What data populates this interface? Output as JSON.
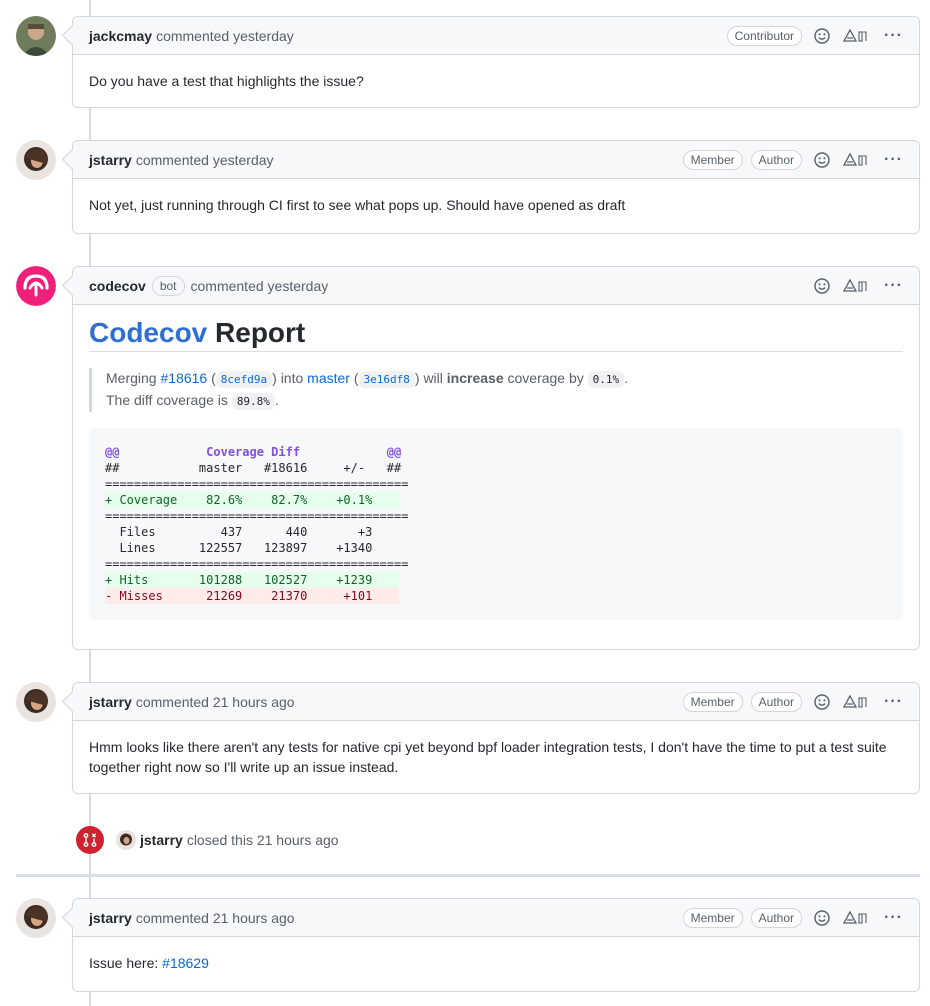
{
  "timeline": [
    {
      "author": "jackcmay",
      "timestamp": "commented yesterday",
      "badges": [
        "Contributor"
      ],
      "body": "Do you have a test that highlights the issue?"
    },
    {
      "author": "jstarry",
      "timestamp": "commented yesterday",
      "badges": [
        "Member",
        "Author"
      ],
      "body": "Not yet, just running through CI first to see what pops up. Should have opened as draft"
    },
    {
      "author": "codecov",
      "bot_label": "bot",
      "timestamp": "commented yesterday",
      "report": {
        "title_brand": "Codecov",
        "title_rest": "Report",
        "merge_text": {
          "merging": "Merging",
          "pr_link": "#18616",
          "head_sha": "8cefd9a",
          "into": "into",
          "base_branch": "master",
          "base_sha": "3e16df8",
          "will": "will",
          "increase": "increase",
          "coverage_by": "coverage by",
          "delta": "0.1%",
          "diff_coverage_text": "The diff coverage is",
          "diff_coverage": "89.8%"
        },
        "diff_lines": [
          {
            "kind": "hunk",
            "text": "@@            Coverage Diff            @@"
          },
          {
            "kind": "plain",
            "text": "##           master   #18616     +/-   ##"
          },
          {
            "kind": "sep",
            "text": "=========================================="
          },
          {
            "kind": "add",
            "text": "+ Coverage    82.6%    82.7%    +0.1%     "
          },
          {
            "kind": "sep",
            "text": "=========================================="
          },
          {
            "kind": "plain",
            "text": "  Files         437      440       +3     "
          },
          {
            "kind": "plain",
            "text": "  Lines      122557   123897    +1340     "
          },
          {
            "kind": "sep",
            "text": "=========================================="
          },
          {
            "kind": "add",
            "text": "+ Hits       101288   102527    +1239     "
          },
          {
            "kind": "del",
            "text": "- Misses      21269    21370     +101     "
          }
        ]
      }
    },
    {
      "author": "jstarry",
      "timestamp": "commented 21 hours ago",
      "badges": [
        "Member",
        "Author"
      ],
      "body": "Hmm looks like there aren't any tests for native cpi yet beyond bpf loader integration tests, I don't have the time to put a test suite together right now so I'll write up an issue instead."
    },
    {
      "event": "closed",
      "actor": "jstarry",
      "text": "closed this 21 hours ago"
    },
    {
      "author": "jstarry",
      "timestamp": "commented 21 hours ago",
      "badges": [
        "Member",
        "Author"
      ],
      "body_prefix": "Issue here:",
      "body_link": "#18629"
    }
  ],
  "icons": {
    "reaction": "smiley-icon",
    "hide": "hide-icon",
    "more": "kebab-horizontal-icon",
    "closed": "git-pull-request-closed-icon"
  },
  "colors": {
    "link": "#0969da",
    "codecov_brand": "#f01f7a",
    "closed_badge": "#cf222e"
  }
}
